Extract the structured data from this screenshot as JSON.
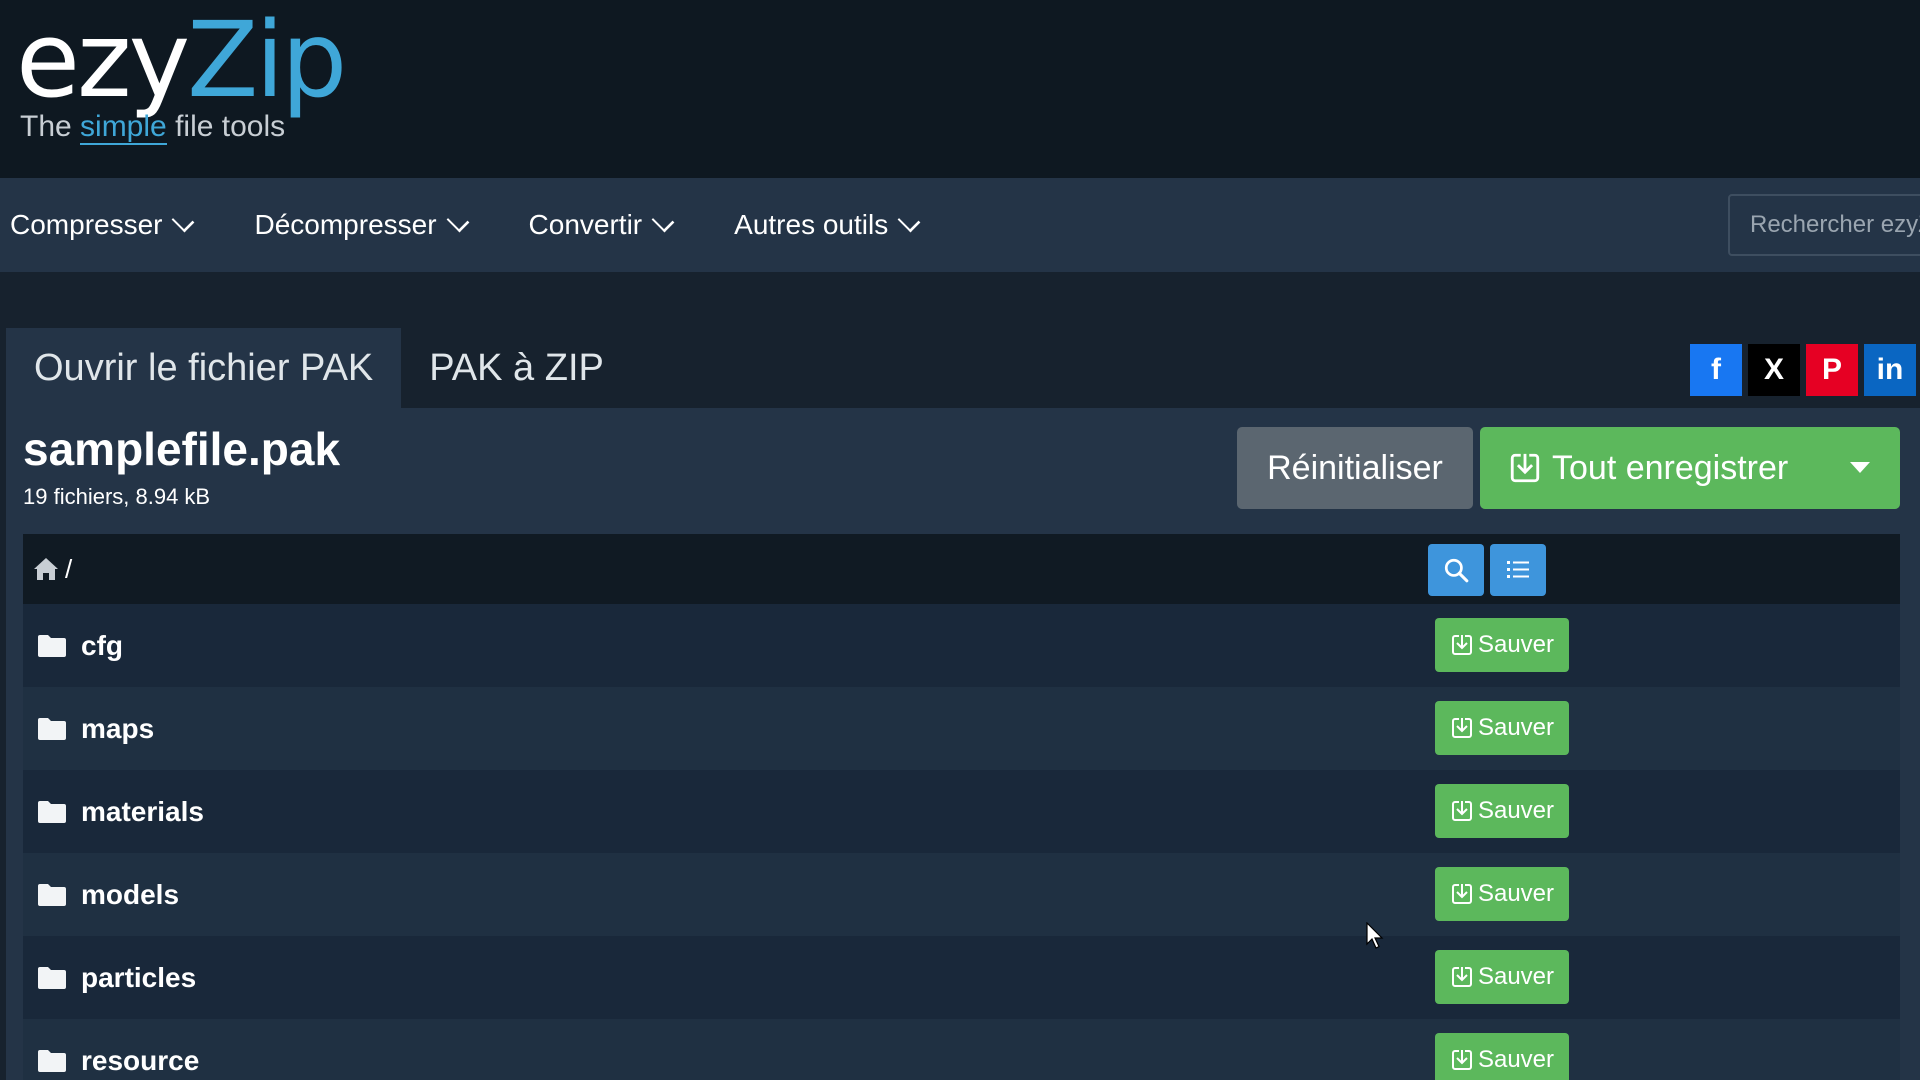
{
  "header": {
    "logo_ezy": "ezy",
    "logo_zip": "Zip",
    "tagline_before": "The ",
    "tagline_simple": "simple",
    "tagline_after": " file tools"
  },
  "nav": {
    "items": [
      {
        "label": "Compresser"
      },
      {
        "label": "Décompresser"
      },
      {
        "label": "Convertir"
      },
      {
        "label": "Autres outils"
      }
    ],
    "search_placeholder": "Rechercher ezyZip"
  },
  "tabs": [
    {
      "label": "Ouvrir le fichier PAK",
      "active": true
    },
    {
      "label": "PAK à ZIP",
      "active": false
    }
  ],
  "social": {
    "facebook": "f",
    "x": "X",
    "pinterest": "P",
    "linkedin": "in"
  },
  "file": {
    "name": "samplefile.pak",
    "meta": "19 fichiers, 8.94 kB",
    "reset_label": "Réinitialiser",
    "save_all_label": "Tout enregistrer"
  },
  "browser": {
    "path": "/",
    "rows": [
      {
        "name": "cfg",
        "save_label": "Sauver"
      },
      {
        "name": "maps",
        "save_label": "Sauver"
      },
      {
        "name": "materials",
        "save_label": "Sauver"
      },
      {
        "name": "models",
        "save_label": "Sauver"
      },
      {
        "name": "particles",
        "save_label": "Sauver"
      },
      {
        "name": "resource",
        "save_label": "Sauver"
      }
    ]
  },
  "colors": {
    "accent_blue": "#3fa7d8",
    "save_green": "#5cb85c",
    "nav_bg": "#243447",
    "header_bg": "#0e1821"
  }
}
